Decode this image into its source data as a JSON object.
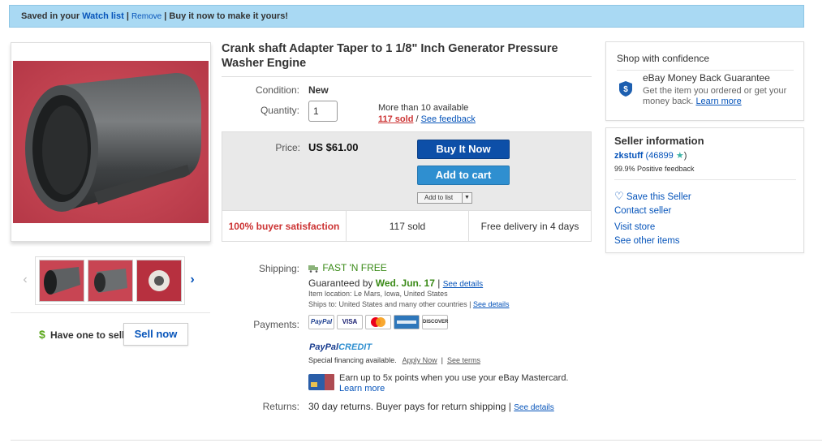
{
  "banner": {
    "prefix": "Saved in your",
    "watch_list": "Watch list",
    "sep1": "|",
    "remove": "Remove",
    "sep2": "|",
    "suffix": "Buy it now to make it yours!"
  },
  "gallery": {
    "prev_icon": "chevron-left-icon",
    "next_icon": "chevron-right-icon"
  },
  "sell": {
    "dollar": "$",
    "question": "Have one to sell?",
    "button": "Sell now"
  },
  "item": {
    "title": "Crank shaft Adapter Taper to 1 1/8\" Inch Generator Pressure Washer Engine",
    "condition_label": "Condition:",
    "condition": "New",
    "quantity_label": "Quantity:",
    "quantity": "1",
    "available": "More than 10 available",
    "sold_count": "117 sold",
    "sold_sep": " / ",
    "see_feedback": "See feedback"
  },
  "buybox": {
    "price_label": "Price:",
    "price": "US $61.00",
    "buy_now": "Buy It Now",
    "add_to_cart": "Add to cart",
    "add_to_list": "Add to list",
    "stats": [
      "100% buyer satisfaction",
      "117 sold",
      "Free delivery in 4 days"
    ]
  },
  "shipping": {
    "label": "Shipping:",
    "fast": "FAST 'N FREE",
    "guaranteed_prefix": "Guaranteed by",
    "guaranteed_date": "Wed. Jun. 17",
    "see_details": "See details",
    "location": "Item location:  Le Mars, Iowa, United States",
    "ships_to": "Ships to:  United States and many other countries",
    "ships_details": "See details"
  },
  "payments": {
    "label": "Payments:",
    "methods": [
      "PayPal",
      "VISA",
      "MC",
      "AMEX",
      "DISCOVER"
    ],
    "paypal_credit_1": "PayPal",
    "paypal_credit_2": "CREDIT",
    "financing": "Special financing available.",
    "apply_now": "Apply Now",
    "see_terms": "See terms",
    "mastercard_promo": "Earn up to 5x points when you use your eBay Mastercard.",
    "learn_more": "Learn more"
  },
  "returns": {
    "label": "Returns:",
    "text": "30 day returns. Buyer pays for return shipping |",
    "see_details": "See details"
  },
  "confidence": {
    "heading": "Shop with confidence",
    "title": "eBay Money Back Guarantee",
    "desc": "Get the item you ordered or get your money back.",
    "learn_more": "Learn more"
  },
  "seller": {
    "heading": "Seller information",
    "name": "zkstuff",
    "score": "(46899",
    "score_close": ")",
    "feedback": "99.9% Positive feedback",
    "save": "Save this Seller",
    "contact": "Contact seller",
    "visit": "Visit store",
    "other": "See other items"
  },
  "colors": {
    "banner_bg": "#a9d9f3",
    "buy_now": "#0d4fa8",
    "add_to_cart": "#2f8fd0",
    "link": "#0654ba",
    "sold_red": "#cc3333",
    "product_bg": "#c84553"
  }
}
